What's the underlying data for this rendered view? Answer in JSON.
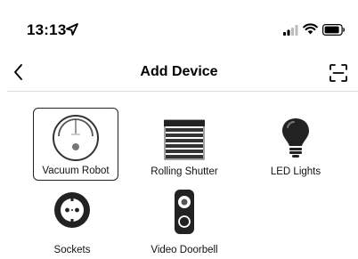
{
  "status_bar": {
    "time": "13:13",
    "icons": [
      "location-arrow-icon",
      "signal-bars-icon",
      "wifi-icon",
      "battery-icon"
    ]
  },
  "nav": {
    "title": "Add Device",
    "back_icon": "chevron-left-icon",
    "scan_icon": "scan-frame-icon"
  },
  "devices": [
    {
      "label": "Vacuum Robot",
      "icon": "robot-vacuum-icon",
      "selected": true
    },
    {
      "label": "Rolling Shutter",
      "icon": "rolling-shutter-icon",
      "selected": false
    },
    {
      "label": "LED Lights",
      "icon": "light-bulb-icon",
      "selected": false
    },
    {
      "label": "Sockets",
      "icon": "socket-icon",
      "selected": false
    },
    {
      "label": "Video Doorbell",
      "icon": "video-doorbell-icon",
      "selected": false
    }
  ],
  "colors": {
    "background": "#ffffff",
    "text": "#000000",
    "divider": "#dcdcdc",
    "icon_dark": "#222222"
  }
}
